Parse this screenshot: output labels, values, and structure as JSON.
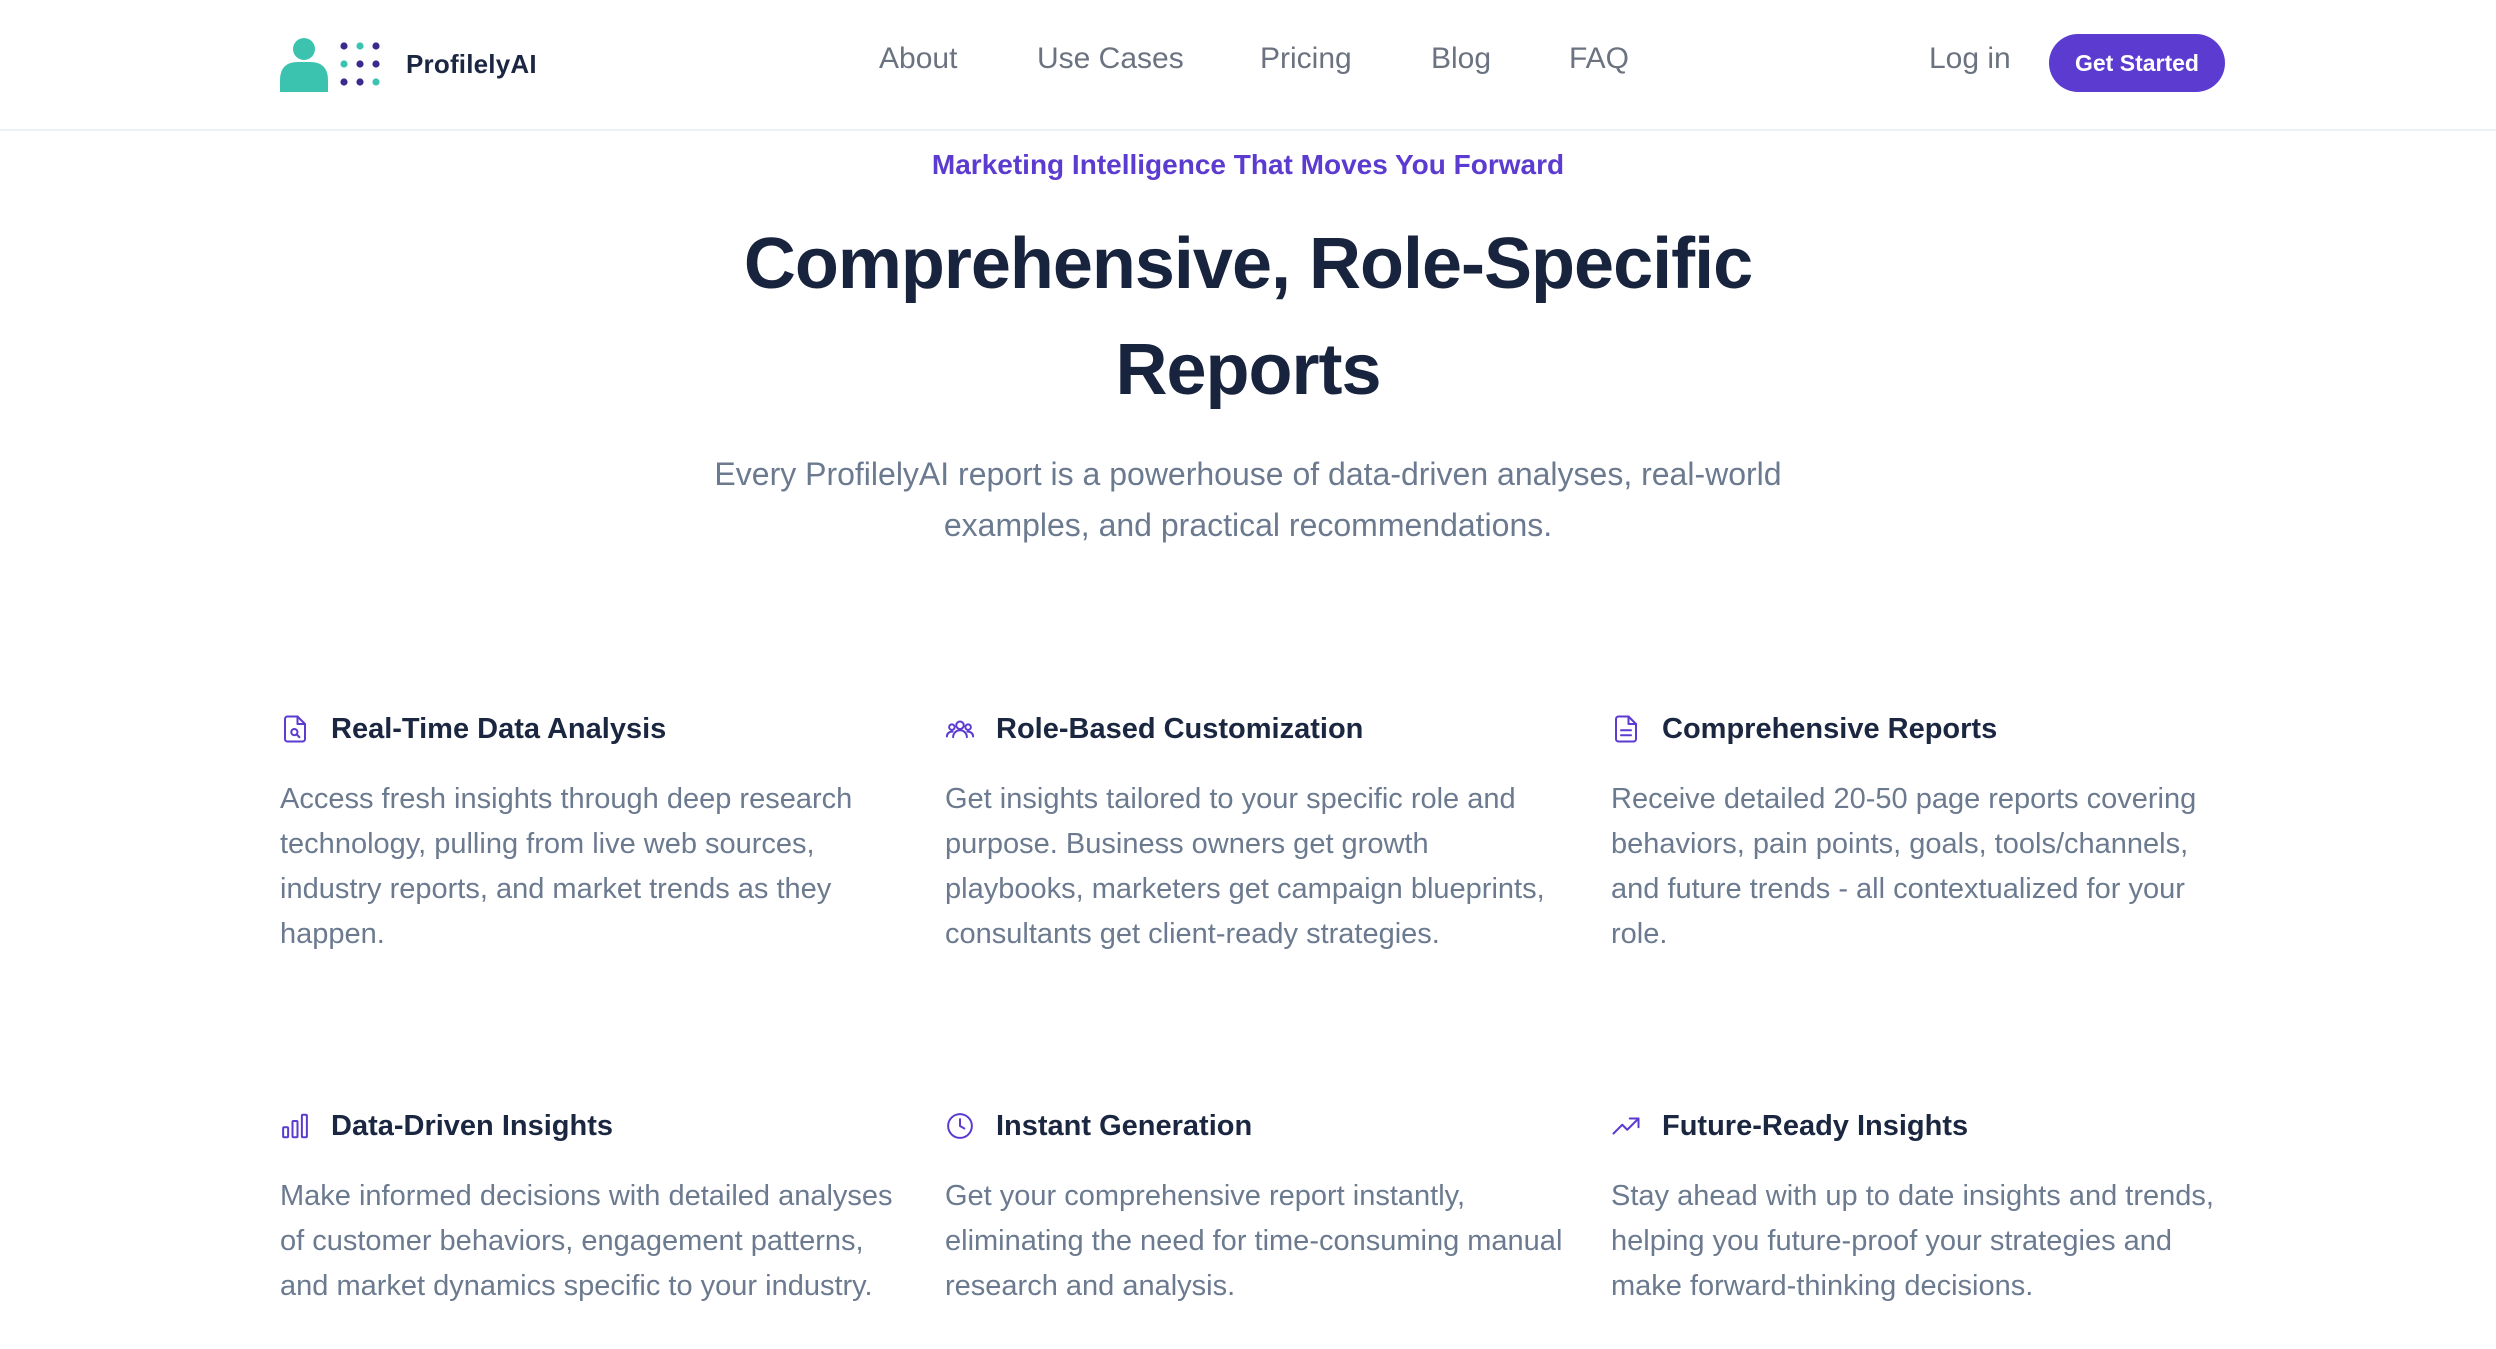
{
  "brand": {
    "name": "ProfilelyAI",
    "accent_color": "#5b3bd0",
    "logo_teal": "#3cc3b0",
    "logo_purple": "#3b2a8f"
  },
  "nav": {
    "links": [
      "About",
      "Use Cases",
      "Pricing",
      "Blog",
      "FAQ"
    ],
    "login_label": "Log in",
    "cta_label": "Get Started"
  },
  "hero": {
    "eyebrow": "Marketing Intelligence That Moves You Forward",
    "title": "Comprehensive, Role-Specific Reports",
    "subtitle": "Every ProfilelyAI report is a powerhouse of data-driven analyses, real-world examples, and practical recommendations."
  },
  "features": [
    {
      "icon": "file-search-icon",
      "title": "Real-Time Data Analysis",
      "description": "Access fresh insights through deep research technology, pulling from live web sources, industry reports, and market trends as they happen."
    },
    {
      "icon": "users-icon",
      "title": "Role-Based Customization",
      "description": "Get insights tailored to your specific role and purpose. Business owners get growth playbooks, marketers get campaign blueprints, consultants get client-ready strategies."
    },
    {
      "icon": "document-icon",
      "title": "Comprehensive Reports",
      "description": "Receive detailed 20-50 page reports covering behaviors, pain points, goals, tools/channels, and future trends - all contextualized for your role."
    },
    {
      "icon": "bar-chart-icon",
      "title": "Data-Driven Insights",
      "description": "Make informed decisions with detailed analyses of customer behaviors, engagement patterns, and market dynamics specific to your industry."
    },
    {
      "icon": "clock-icon",
      "title": "Instant Generation",
      "description": "Get your comprehensive report instantly, eliminating the need for time-consuming manual research and analysis."
    },
    {
      "icon": "trending-up-icon",
      "title": "Future-Ready Insights",
      "description": "Stay ahead with up to date insights and trends, helping you future-proof your strategies and make forward-thinking decisions."
    }
  ]
}
